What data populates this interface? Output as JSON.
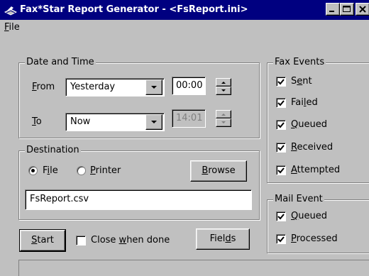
{
  "window": {
    "title": "Fax*Star Report Generator - <FsReport.ini>"
  },
  "menu": {
    "file_prefix": "",
    "file_accel": "F",
    "file_rest": "ile"
  },
  "date_time": {
    "group_label": "Date and Time",
    "from_accel": "F",
    "from_rest": "rom",
    "from_value": "Yesterday",
    "from_time": "00:00",
    "to_accel": "T",
    "to_rest": "o",
    "to_value": "Now",
    "to_time": "14:01"
  },
  "destination": {
    "group_label": "Destination",
    "file_accel": "i",
    "file_pre": "F",
    "file_post": "le",
    "printer_accel": "P",
    "printer_rest": "rinter",
    "browse_accel": "B",
    "browse_rest": "rowse",
    "path_value": "FsReport.csv",
    "selected": "File"
  },
  "fax_events": {
    "group_label": "Fax Events",
    "items": [
      {
        "pre": "S",
        "accel": "e",
        "post": "nt",
        "checked": true
      },
      {
        "pre": "Fai",
        "accel": "l",
        "post": "ed",
        "checked": true
      },
      {
        "pre": "",
        "accel": "Q",
        "post": "ueued",
        "checked": true
      },
      {
        "pre": "",
        "accel": "R",
        "post": "eceived",
        "checked": true
      },
      {
        "pre": "",
        "accel": "A",
        "post": "ttempted",
        "checked": true
      }
    ]
  },
  "mail_event": {
    "group_label": "Mail Event",
    "items": [
      {
        "pre": "",
        "accel": "Q",
        "post": "ueued",
        "checked": true
      },
      {
        "pre": "",
        "accel": "P",
        "post": "rocessed",
        "checked": true
      }
    ]
  },
  "bottom": {
    "start_accel": "S",
    "start_rest": "tart",
    "close_pre": "Close ",
    "close_accel": "w",
    "close_post": "hen done",
    "close_checked": false,
    "fields_pre": "Fiel",
    "fields_accel": "d",
    "fields_post": "s"
  },
  "icons": {
    "window_icon": "fax-machine-icon",
    "check": "check-mark-icon"
  }
}
